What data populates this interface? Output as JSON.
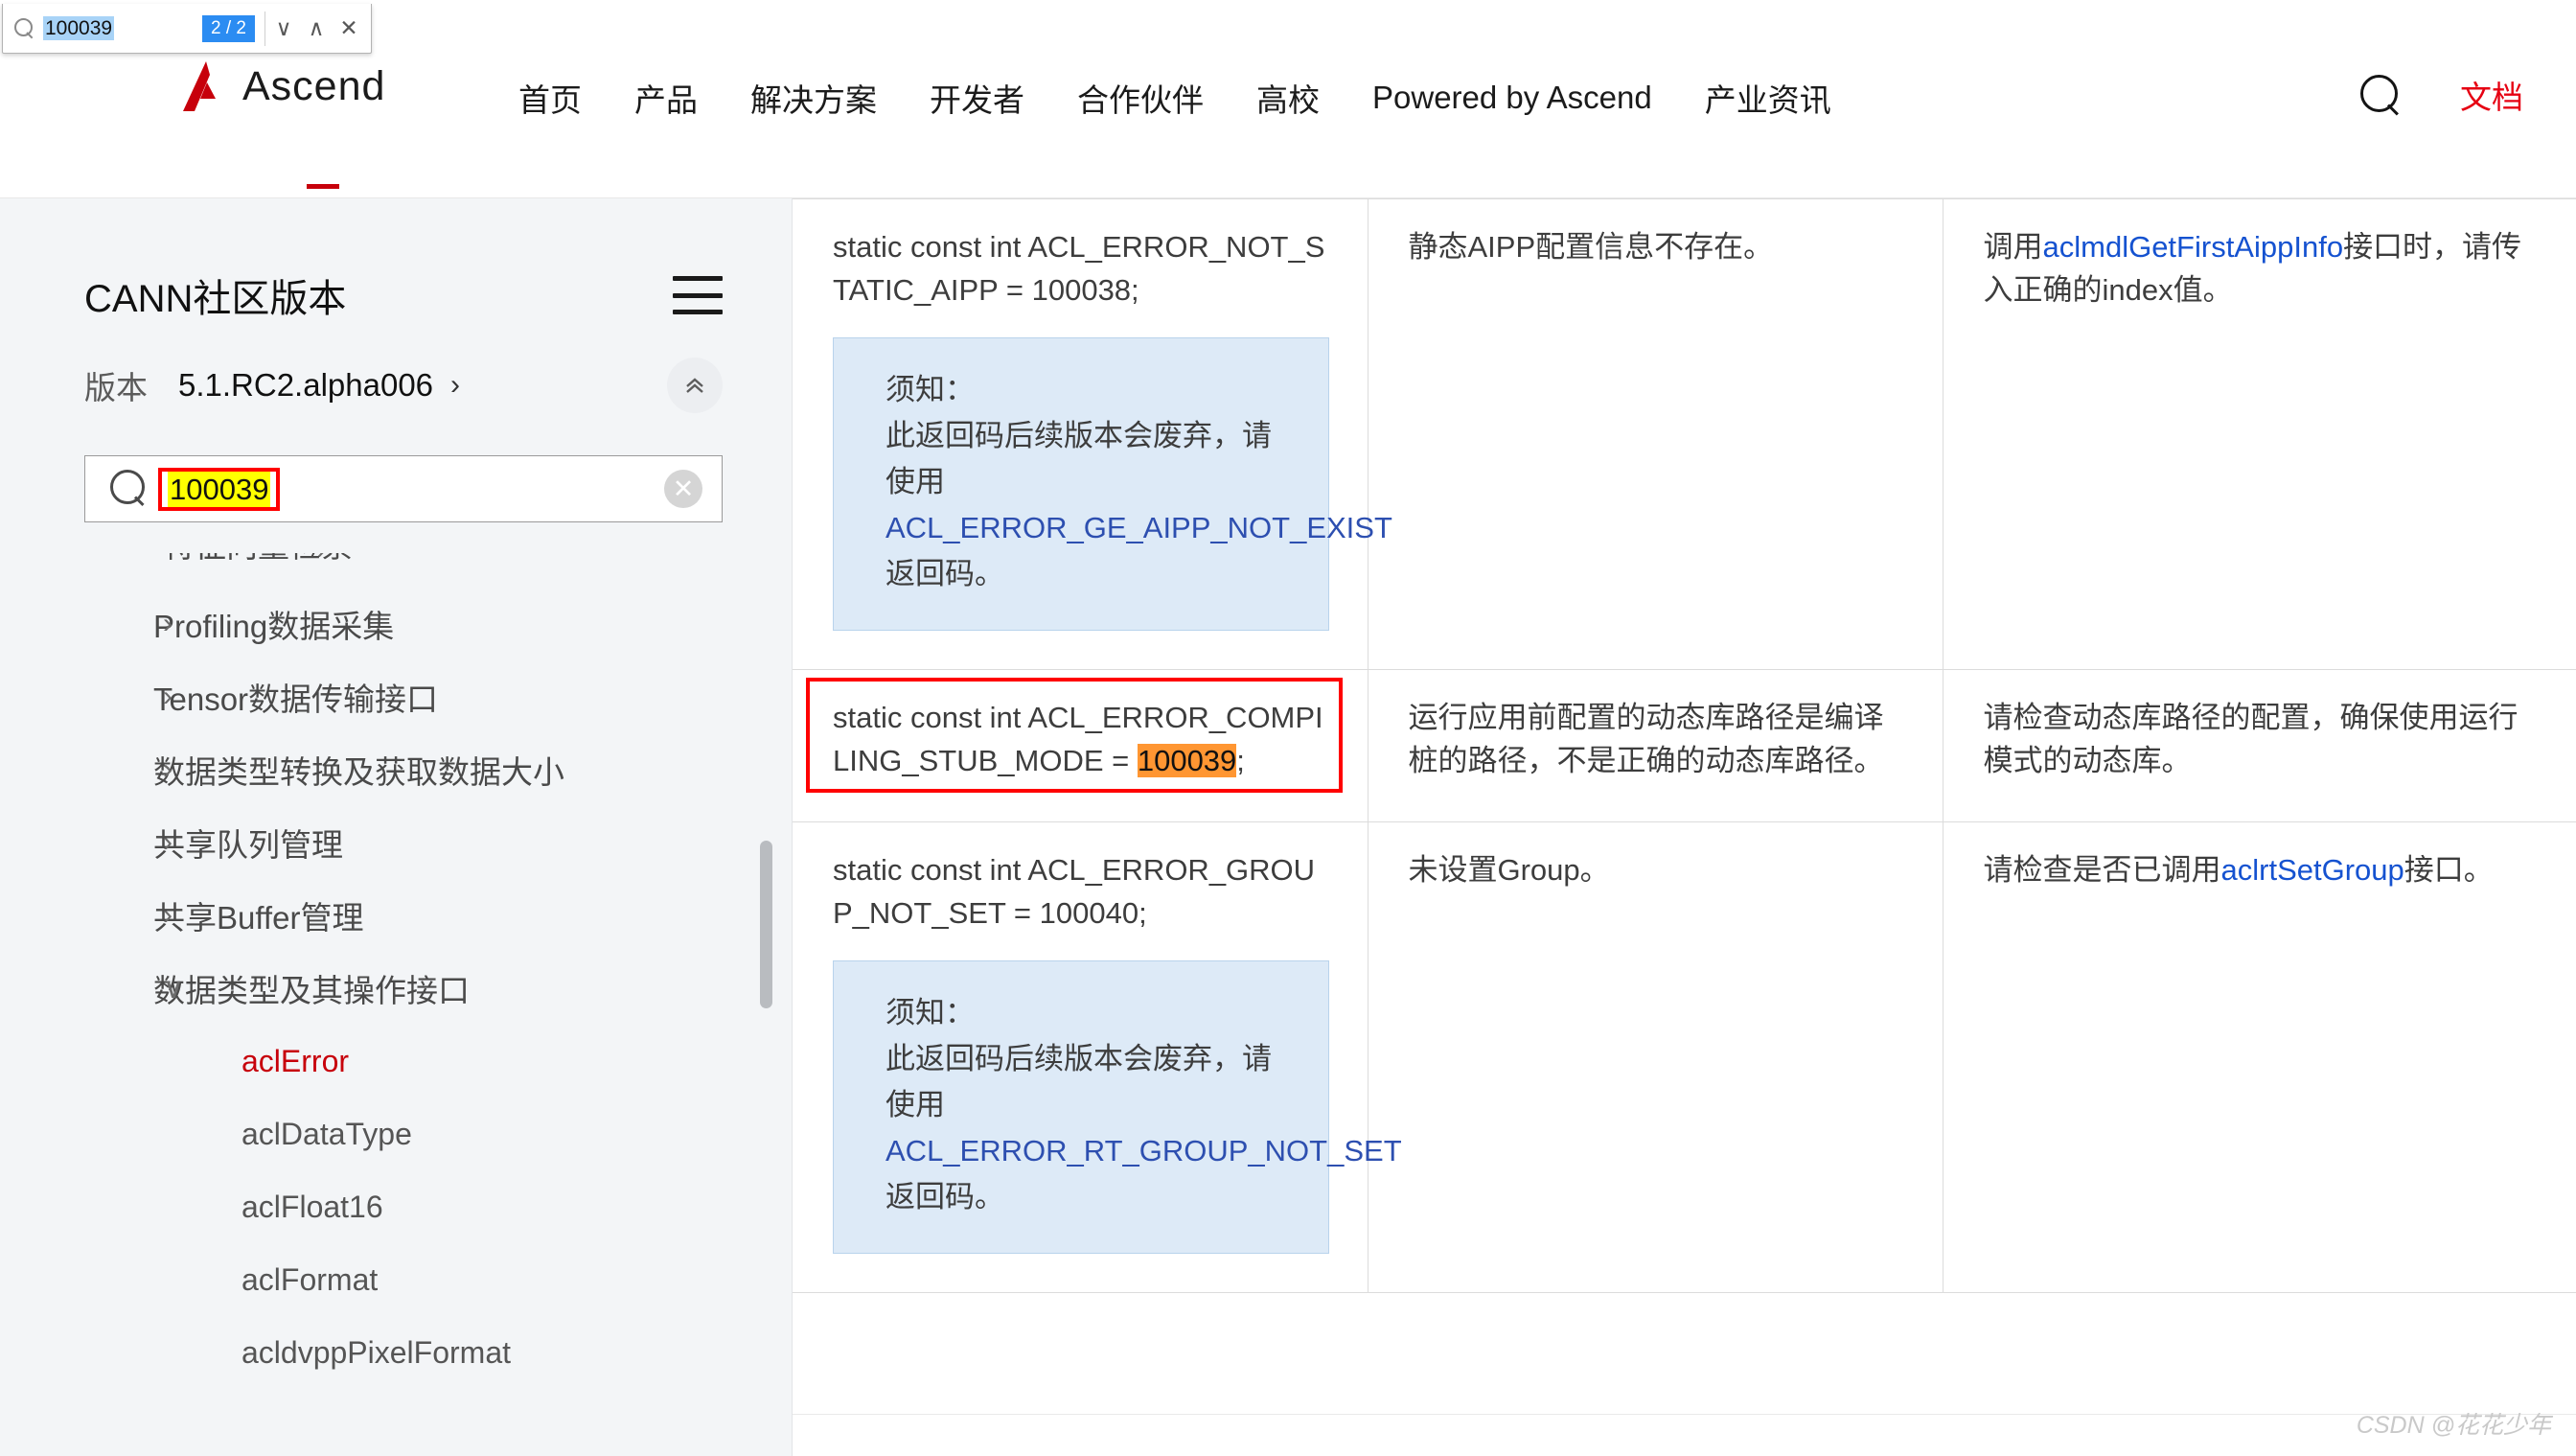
{
  "findbar": {
    "query": "100039",
    "match_count": "2 / 2",
    "next_label": "∨",
    "prev_label": "∧",
    "close_label": "✕",
    "search_icon": "search-icon"
  },
  "topnav": {
    "logo_text": "Ascend",
    "items": [
      "首页",
      "产品",
      "解决方案",
      "开发者",
      "合作伙伴",
      "高校",
      "Powered by Ascend",
      "产业资讯"
    ],
    "search_icon": "search-icon",
    "docs_label": "文档",
    "docs_color": "#e60012"
  },
  "sidebar": {
    "title": "CANN社区版本",
    "menu_icon": "hamburger-icon",
    "version_label": "版本",
    "version_value": "5.1.RC2.alpha006",
    "version_caret": "›",
    "collapse_icon": "«",
    "search_value": "100039",
    "search_highlight_color": "#ffff00",
    "clear_icon": "✕",
    "tree": [
      {
        "label": "特征向量检索",
        "type": "group",
        "chevron": "›",
        "clipped": true
      },
      {
        "label": "Profiling数据采集",
        "type": "group",
        "chevron": "›"
      },
      {
        "label": "Tensor数据传输接口",
        "type": "group",
        "chevron": "›"
      },
      {
        "label": "数据类型转换及获取数据大小",
        "type": "group",
        "chevron": "›"
      },
      {
        "label": "共享队列管理",
        "type": "group",
        "chevron": "›"
      },
      {
        "label": "共享Buffer管理",
        "type": "group",
        "chevron": "›"
      },
      {
        "label": "数据类型及其操作接口",
        "type": "group-open",
        "chevron": "∨"
      },
      {
        "label": "aclError",
        "type": "leaf",
        "active": true
      },
      {
        "label": "aclDataType",
        "type": "leaf"
      },
      {
        "label": "aclFloat16",
        "type": "leaf"
      },
      {
        "label": "aclFormat",
        "type": "leaf"
      },
      {
        "label": "acldvppPixelFormat",
        "type": "leaf"
      }
    ]
  },
  "table": {
    "rows": [
      {
        "code_pre": "static const int ACL_ERROR_NOT_STATIC_AIPP = 100038;",
        "note": {
          "title": "须知：",
          "text_before": "此返回码后续版本会废弃，请使用",
          "link": "ACL_ERROR_GE_AIPP_NOT_EXIST",
          "text_after": "返回码。"
        },
        "desc": "静态AIPP配置信息不存在。",
        "solution_before": "调用",
        "solution_link": "aclmdlGetFirstAippInfo",
        "solution_after": "接口时，请传入正确的index值。"
      },
      {
        "code_prefix": "static const int ACL_ERROR_COMPILING_STUB_MODE = ",
        "code_highlight": "100039",
        "code_suffix": ";",
        "highlighted": true,
        "desc": "运行应用前配置的动态库路径是编译桩的路径，不是正确的动态库路径。",
        "solution": "请检查动态库路径的配置，确保使用运行模式的动态库。"
      },
      {
        "code_pre": "static const int ACL_ERROR_GROUP_NOT_SET = 100040;",
        "note": {
          "title": "须知：",
          "text_before": "此返回码后续版本会废弃，请使用",
          "link": "ACL_ERROR_RT_GROUP_NOT_SET",
          "text_after": "返回码。"
        },
        "desc": "未设置Group。",
        "solution_before": "请检查是否已调用",
        "solution_link": "aclrtSetGroup",
        "solution_after": "接口。"
      }
    ]
  },
  "watermark": "CSDN @花花少年"
}
